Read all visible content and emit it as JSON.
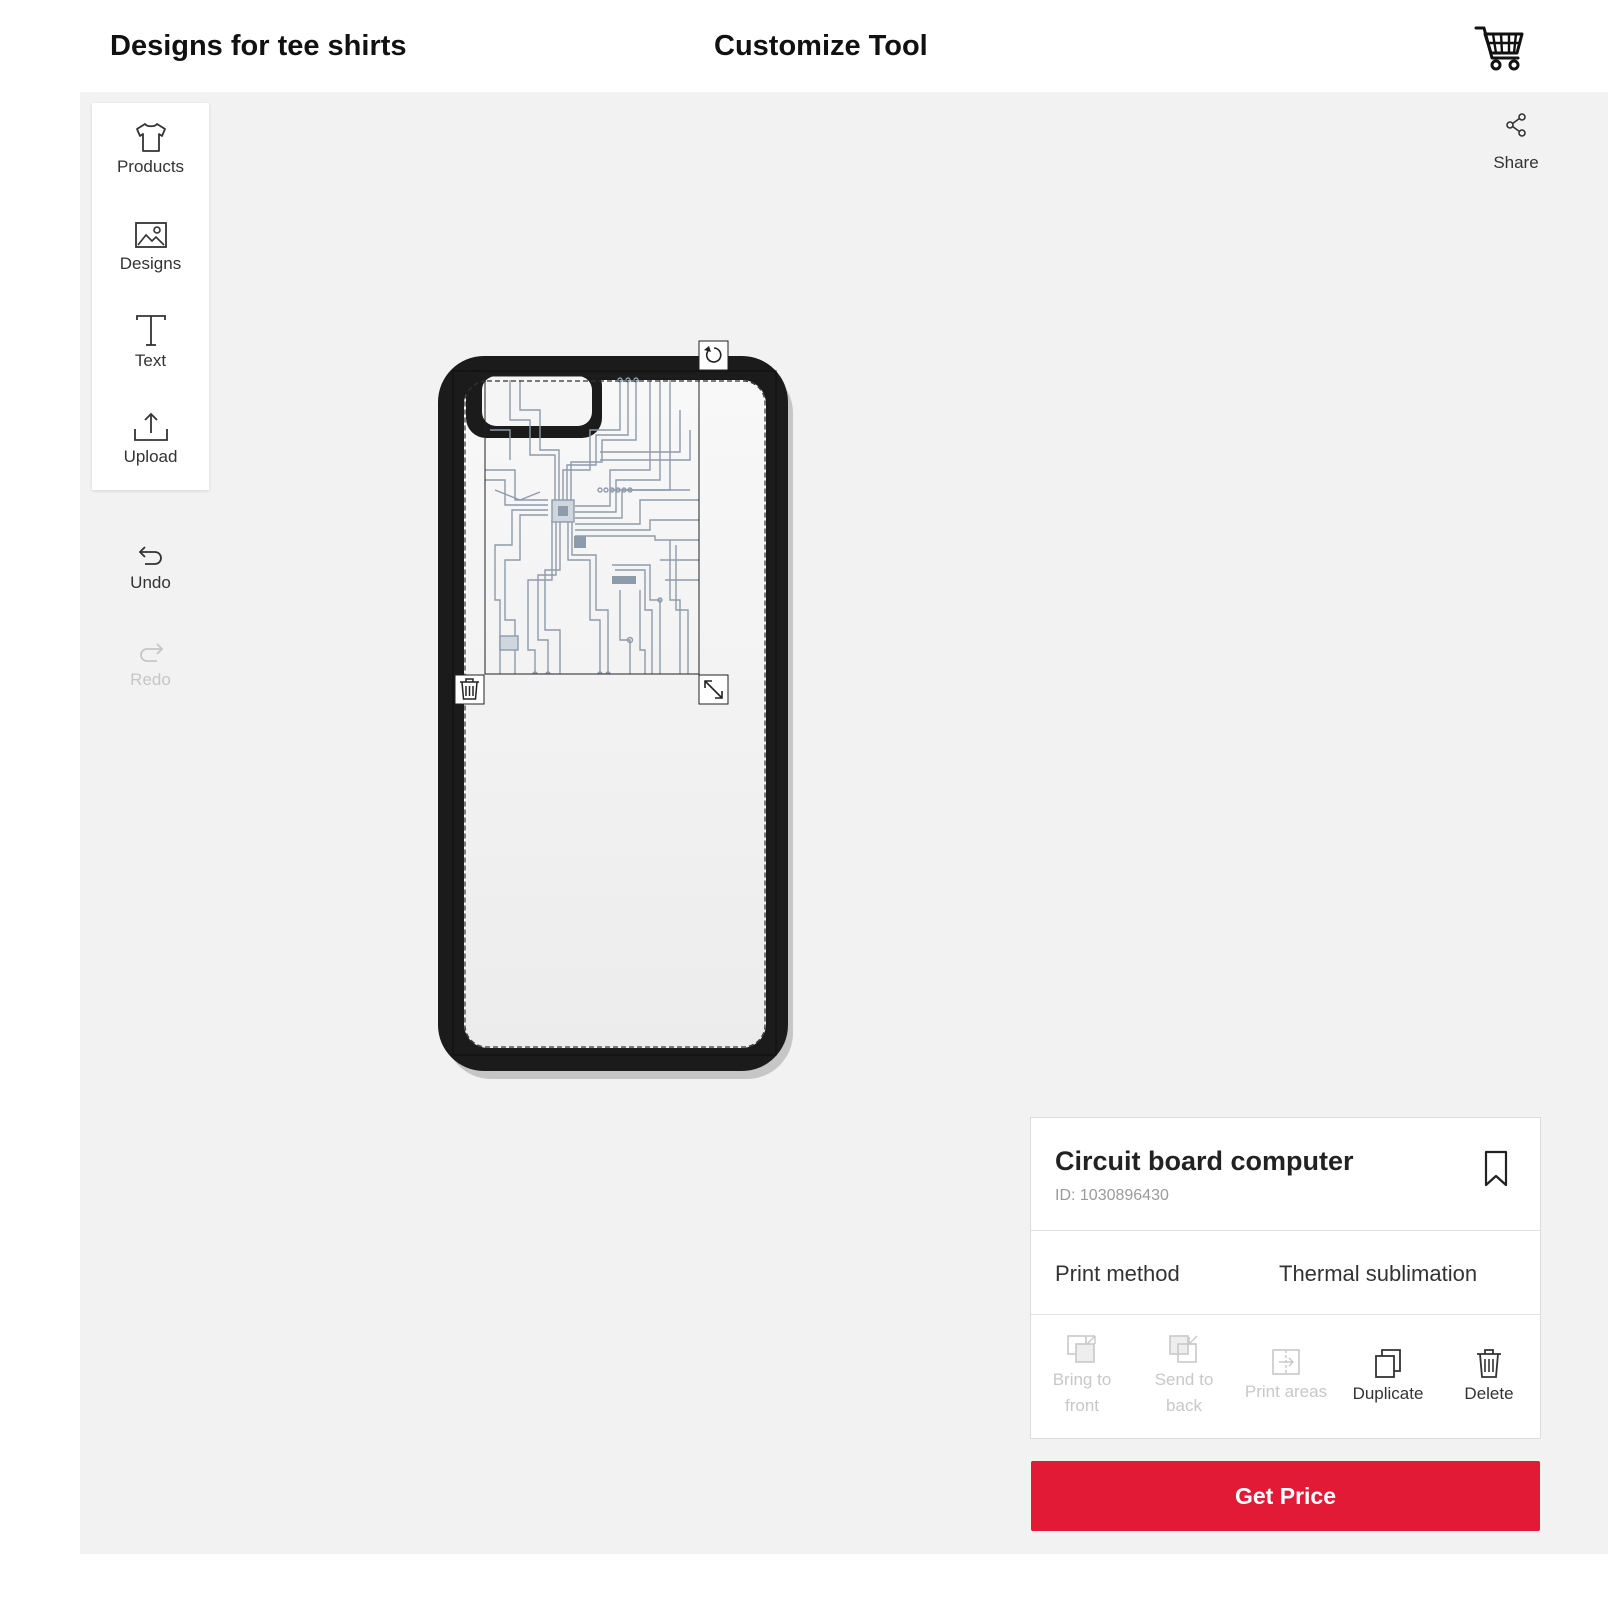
{
  "header": {
    "site_title": "Designs for tee shirts",
    "tool_title": "Customize Tool",
    "cart_icon": "shopping-cart-icon"
  },
  "toolbar": {
    "items": [
      {
        "label": "Products",
        "icon": "tshirt-icon"
      },
      {
        "label": "Designs",
        "icon": "image-icon"
      },
      {
        "label": "Text",
        "icon": "text-icon"
      },
      {
        "label": "Upload",
        "icon": "upload-icon"
      }
    ]
  },
  "history": {
    "undo_label": "Undo",
    "redo_label": "Redo",
    "redo_enabled": false
  },
  "share": {
    "label": "Share",
    "icon": "share-icon"
  },
  "canvas": {
    "product": "phone case",
    "case_color": "#1a1a1a",
    "design_line_color": "#8d9bab",
    "selection_handles": [
      "rotate-icon",
      "delete-icon",
      "resize-icon"
    ]
  },
  "design_panel": {
    "name": "Circuit board computer",
    "id_text": "ID: 1030896430",
    "print_method_label": "Print method",
    "print_method_value": "Thermal sublimation",
    "actions": [
      {
        "label": "Bring to front",
        "enabled": false
      },
      {
        "label": "Send to back",
        "enabled": false
      },
      {
        "label": "Print areas",
        "enabled": false
      },
      {
        "label": "Duplicate",
        "enabled": true
      },
      {
        "label": "Delete",
        "enabled": true
      }
    ]
  },
  "cta": {
    "label": "Get Price",
    "color": "#e31a35"
  }
}
